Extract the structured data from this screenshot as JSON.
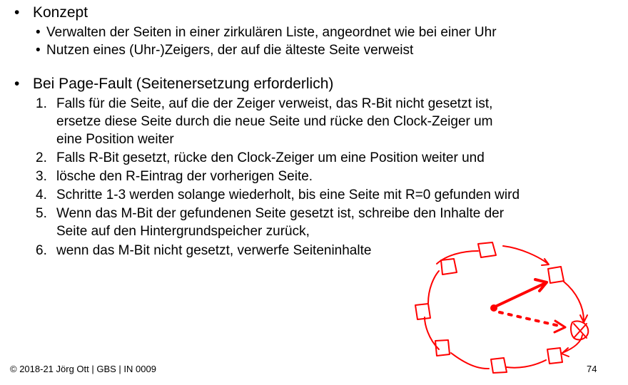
{
  "section1": {
    "bullet": "•",
    "heading": "Konzept",
    "subitems": [
      "Verwalten der Seiten in einer zirkulären Liste, angeordnet wie bei einer Uhr",
      "Nutzen eines (Uhr-)Zeigers, der auf die älteste Seite verweist"
    ]
  },
  "section2": {
    "bullet": "•",
    "heading": "Bei Page-Fault (Seitenersetzung erforderlich)",
    "steps": [
      {
        "num": "1.",
        "lines": [
          "Falls für die Seite, auf die der Zeiger verweist, das R-Bit nicht gesetzt ist,",
          "ersetze diese Seite durch die neue Seite und rücke den Clock-Zeiger um",
          "eine Position weiter"
        ]
      },
      {
        "num": "2.",
        "lines": [
          "Falls R-Bit gesetzt, rücke den Clock-Zeiger um eine Position weiter und"
        ]
      },
      {
        "num": "3.",
        "lines": [
          "lösche den R-Eintrag der vorherigen Seite."
        ]
      },
      {
        "num": "4.",
        "lines": [
          "Schritte 1-3 werden solange wiederholt, bis eine Seite mit R=0 gefunden wird"
        ]
      },
      {
        "num": "5.",
        "lines": [
          "Wenn das M-Bit der gefundenen Seite gesetzt ist, schreibe den Inhalte der",
          "Seite auf den Hintergrundspeicher zurück,"
        ]
      },
      {
        "num": "6.",
        "lines": [
          "wenn das M-Bit nicht gesetzt, verwerfe Seiteninhalte"
        ]
      }
    ]
  },
  "footer": {
    "copyright": "© 2018-21 Jörg Ott | GBS | IN 0009",
    "page_number": "74"
  },
  "colors": {
    "text": "#000000",
    "annotation": "#ff0000"
  },
  "icons": {
    "sketch": "clock-sketch-icon"
  }
}
